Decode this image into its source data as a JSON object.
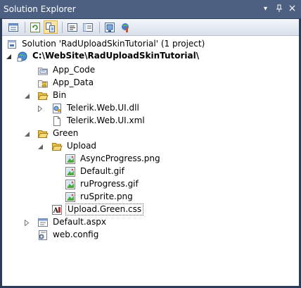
{
  "window": {
    "title": "Solution Explorer",
    "controls": {
      "dropdown": "▾",
      "pin": "ᵠ",
      "close": "×"
    }
  },
  "toolbar": {
    "buttons": [
      {
        "icon": "properties-icon"
      },
      {
        "icon": "refresh-icon"
      },
      {
        "icon": "nest-related-files-icon"
      },
      {
        "icon": "view-code-icon"
      },
      {
        "icon": "view-designer-icon"
      },
      {
        "icon": "copy-website-icon"
      },
      {
        "icon": "asp-net-configuration-icon"
      }
    ]
  },
  "tree": {
    "solution": "Solution 'RadUploadSkinTutorial' (1 project)",
    "project": "C:\\WebSite\\RadUploadSkinTutorial\\",
    "items": {
      "app_code": "App_Code",
      "app_data": "App_Data",
      "bin": "Bin",
      "telerik_dll": "Telerik.Web.UI.dll",
      "telerik_xml": "Telerik.Web.UI.xml",
      "green": "Green",
      "upload": "Upload",
      "asyncprogress": "AsyncProgress.png",
      "default_gif": "Default.gif",
      "ruprogress": "ruProgress.gif",
      "rusprite": "ruSprite.png",
      "upload_css": "Upload.Green.css",
      "default_aspx": "Default.aspx",
      "web_config": "web.config"
    }
  },
  "colors": {
    "title_bg": "#4d6082",
    "frame": "#2b3c59",
    "folder": "#e8c04a"
  }
}
